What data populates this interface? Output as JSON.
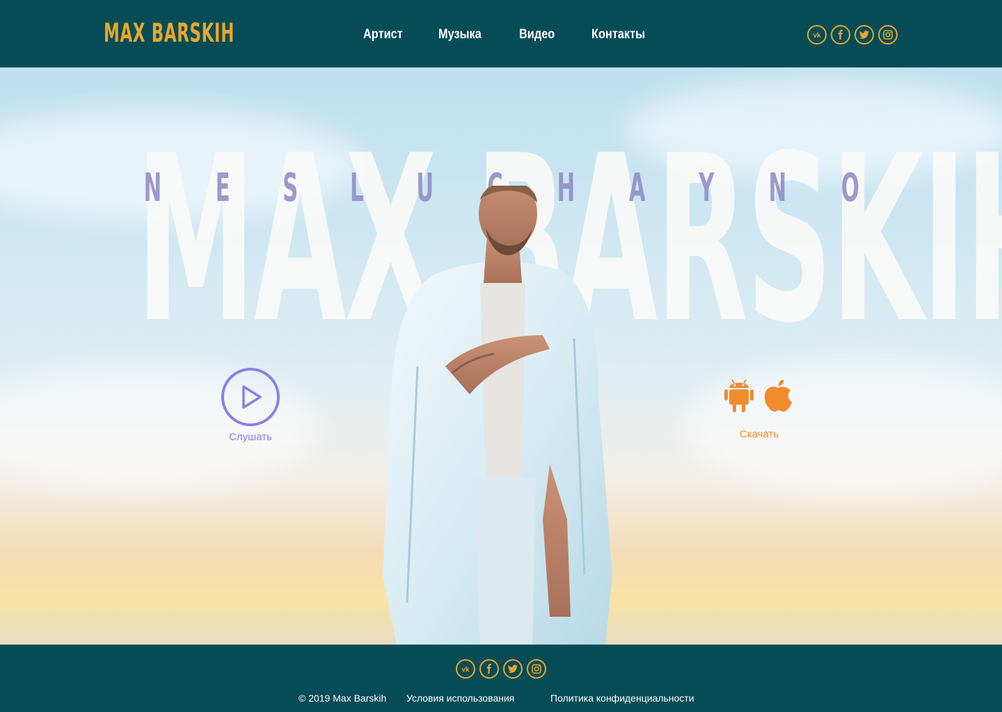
{
  "header": {
    "logo": "MAX BARSKIH",
    "nav": [
      "Артист",
      "Музыка",
      "Видео",
      "Контакты"
    ],
    "social": [
      "vk-icon",
      "facebook-icon",
      "twitter-icon",
      "instagram-icon"
    ]
  },
  "hero": {
    "big_title": "MAX BARSKIH",
    "subtitle_letters": [
      "N",
      "E",
      "S",
      "L",
      "U",
      "C",
      "H",
      "A",
      "Y",
      "N",
      "O"
    ],
    "listen_label": "Слушать",
    "download_label": "Скачать",
    "store_icons": [
      "android-icon",
      "apple-icon"
    ]
  },
  "footer": {
    "social": [
      "vk-icon",
      "facebook-icon",
      "twitter-icon",
      "instagram-icon"
    ],
    "copyright": "© 2019 Max Barskih",
    "terms": "Условия использования",
    "privacy": "Политика конфиденциальности"
  },
  "colors": {
    "brand_bg": "#064c57",
    "accent_gold": "#e8a62b",
    "play_purple": "#8b7fe6",
    "download_orange": "#f28a2e"
  }
}
